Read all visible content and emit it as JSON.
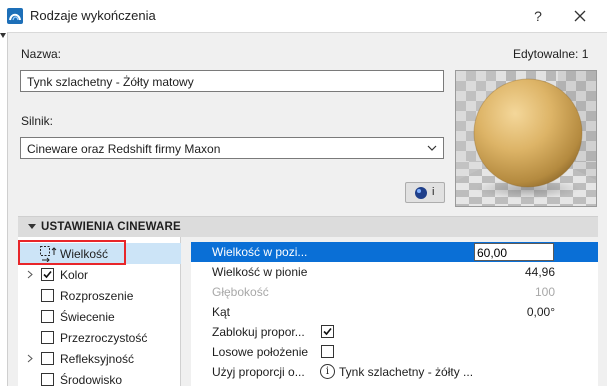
{
  "window": {
    "title": "Rodzaje wykończenia",
    "help_label": "?",
    "close_icon": "close-icon"
  },
  "form": {
    "name_label": "Nazwa:",
    "editable_label": "Edytowalne: 1",
    "name_value": "Tynk szlachetny - Żółty matowy",
    "engine_label": "Silnik:",
    "engine_value": "Cineware oraz Redshift firmy Maxon",
    "render_button_label": "i"
  },
  "section": {
    "title": "USTAWIENIA CINEWARE"
  },
  "tree": {
    "items": [
      {
        "label": "Wielkość",
        "checked": null,
        "expandable": false,
        "selected": true,
        "icon": "size-icon"
      },
      {
        "label": "Kolor",
        "checked": true,
        "expandable": true,
        "selected": false
      },
      {
        "label": "Rozproszenie",
        "checked": false,
        "expandable": false,
        "selected": false
      },
      {
        "label": "Świecenie",
        "checked": false,
        "expandable": false,
        "selected": false
      },
      {
        "label": "Przezroczystość",
        "checked": false,
        "expandable": false,
        "selected": false
      },
      {
        "label": "Refleksyjność",
        "checked": false,
        "expandable": true,
        "selected": false
      },
      {
        "label": "Środowisko",
        "checked": false,
        "expandable": false,
        "selected": false
      }
    ]
  },
  "properties": {
    "rows": [
      {
        "name": "Wielkość w pozi...",
        "value": "60,00"
      },
      {
        "name": "Wielkość w pionie",
        "value": "44,96"
      },
      {
        "name": "Głębokość",
        "value": "100"
      },
      {
        "name": "Kąt",
        "value": "0,00°"
      },
      {
        "name": "Zablokuj propor...",
        "value": true
      },
      {
        "name": "Losowe położenie",
        "value": false
      },
      {
        "name": "Użyj proporcji o...",
        "value": "Tynk szlachetny - żółty ..."
      }
    ]
  },
  "colors": {
    "selection_blue": "#0a6fd6",
    "tree_selection": "#cce4f7",
    "highlight_red": "#e8262a",
    "dialog_bg": "#f0f0f0"
  }
}
